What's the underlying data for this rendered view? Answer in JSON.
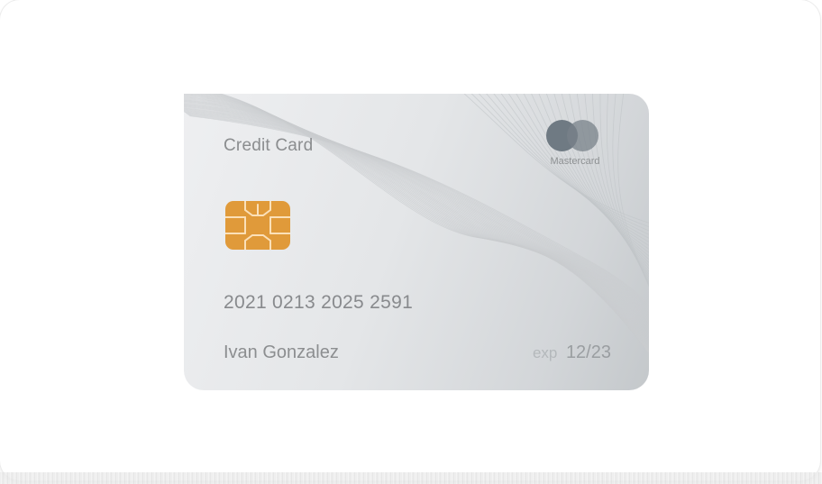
{
  "card": {
    "title": "Credit Card",
    "brand": "Mastercard",
    "number": "2021 0213 2025 2591",
    "holder": "Ivan Gonzalez",
    "exp_label": "exp",
    "exp_value": "12/23"
  },
  "colors": {
    "chip": "#e09a3a",
    "logo_left": "#6f7a83",
    "logo_right": "#78828a",
    "text": "#8b8d8f"
  },
  "icons": [
    "chip-icon",
    "mastercard-logo-icon"
  ]
}
